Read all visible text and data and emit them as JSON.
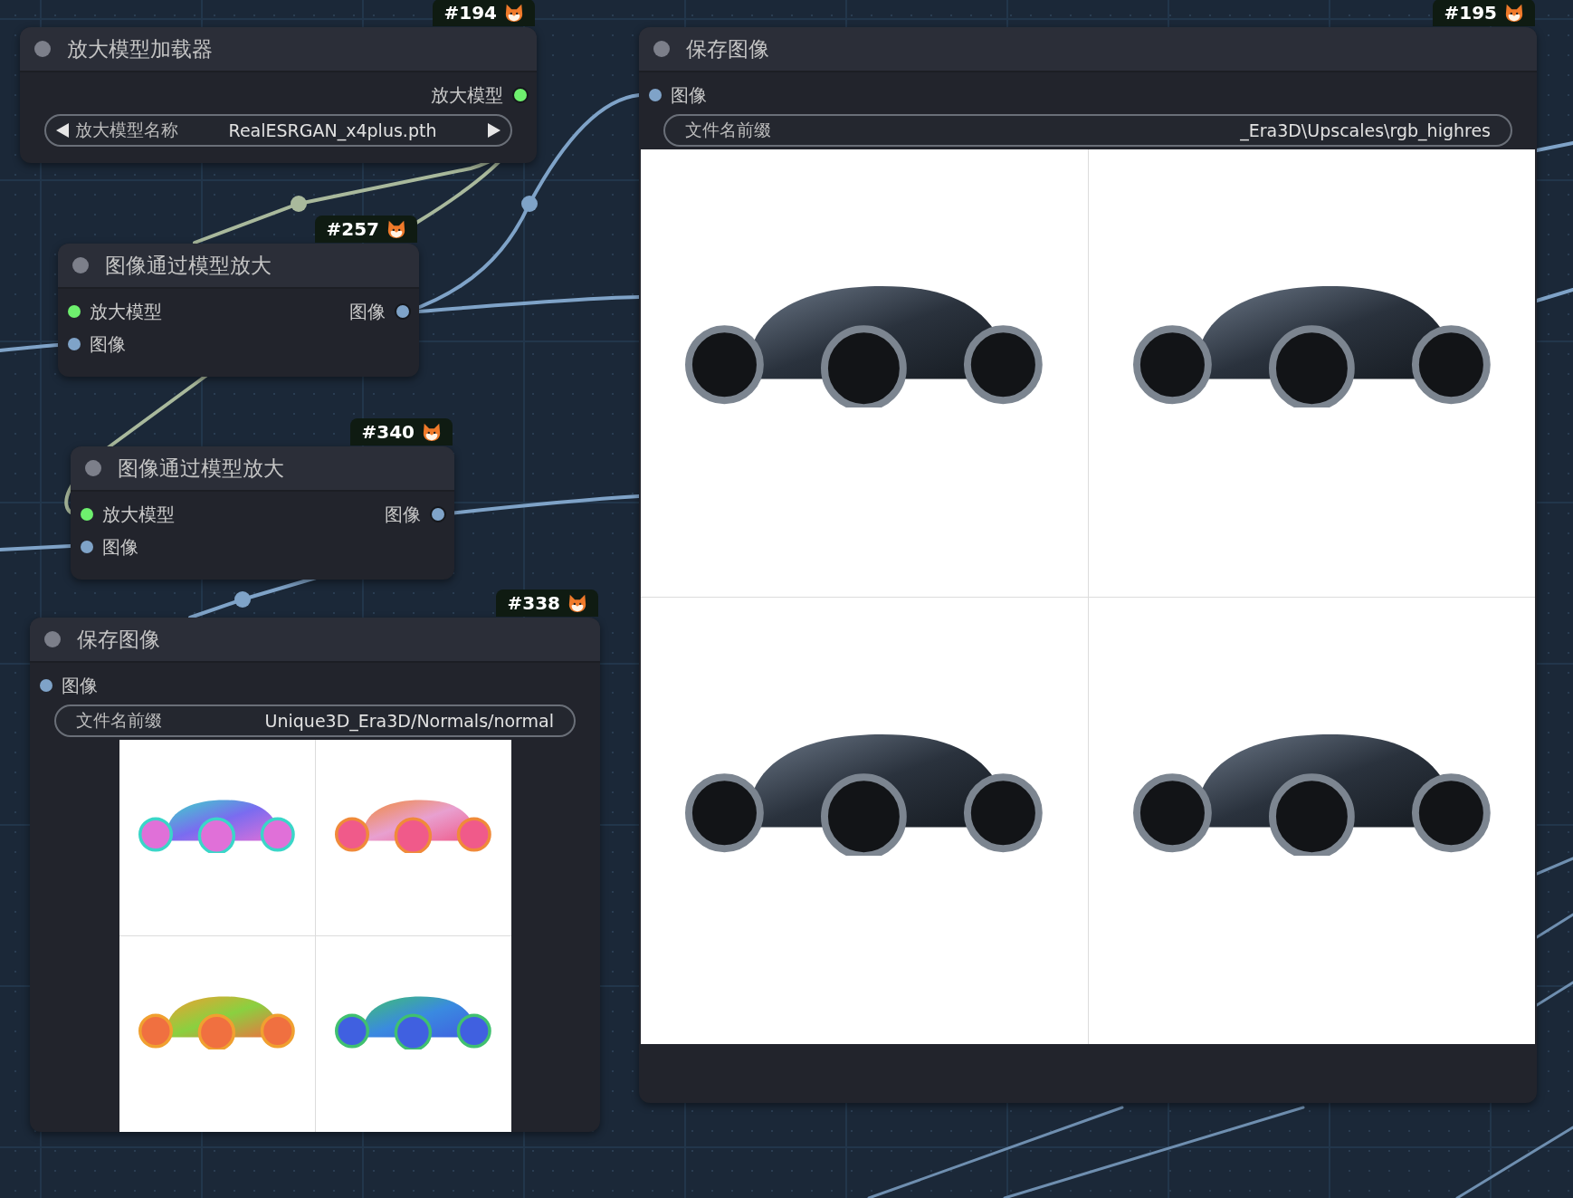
{
  "nodes": [
    {
      "badge": "#194",
      "title": "放大模型加载器",
      "outputs": [
        {
          "label": "放大模型",
          "color": "#6ef06e"
        }
      ],
      "widgets": [
        {
          "kind": "combo",
          "label": "放大模型名称",
          "value": "RealESRGAN_x4plus.pth"
        }
      ]
    },
    {
      "badge": "#257",
      "title": "图像通过模型放大",
      "inputs": [
        {
          "label": "放大模型",
          "color": "#6ef06e"
        },
        {
          "label": "图像",
          "color": "#7fa3c8"
        }
      ],
      "outputs": [
        {
          "label": "图像",
          "color": "#7fa3c8"
        }
      ]
    },
    {
      "badge": "#340",
      "title": "图像通过模型放大",
      "inputs": [
        {
          "label": "放大模型",
          "color": "#6ef06e"
        },
        {
          "label": "图像",
          "color": "#7fa3c8"
        }
      ],
      "outputs": [
        {
          "label": "图像",
          "color": "#7fa3c8"
        }
      ]
    },
    {
      "badge": "#338",
      "title": "保存图像",
      "inputs": [
        {
          "label": "图像",
          "color": "#7fa3c8"
        }
      ],
      "widgets": [
        {
          "kind": "text",
          "label": "文件名前缀",
          "value": "Unique3D_Era3D/Normals/normal"
        }
      ],
      "previews": [
        {
          "kind": "normal"
        },
        {
          "kind": "normal"
        },
        {
          "kind": "normal"
        },
        {
          "kind": "normal"
        }
      ]
    },
    {
      "badge": "#195",
      "title": "保存图像",
      "inputs": [
        {
          "label": "图像",
          "color": "#7fa3c8"
        }
      ],
      "widgets": [
        {
          "kind": "text",
          "label": "文件名前缀",
          "value": "_Era3D\\Upscales\\rgb_highres"
        }
      ],
      "previews": [
        {
          "kind": "render"
        },
        {
          "kind": "render"
        },
        {
          "kind": "render"
        },
        {
          "kind": "render"
        }
      ]
    }
  ]
}
